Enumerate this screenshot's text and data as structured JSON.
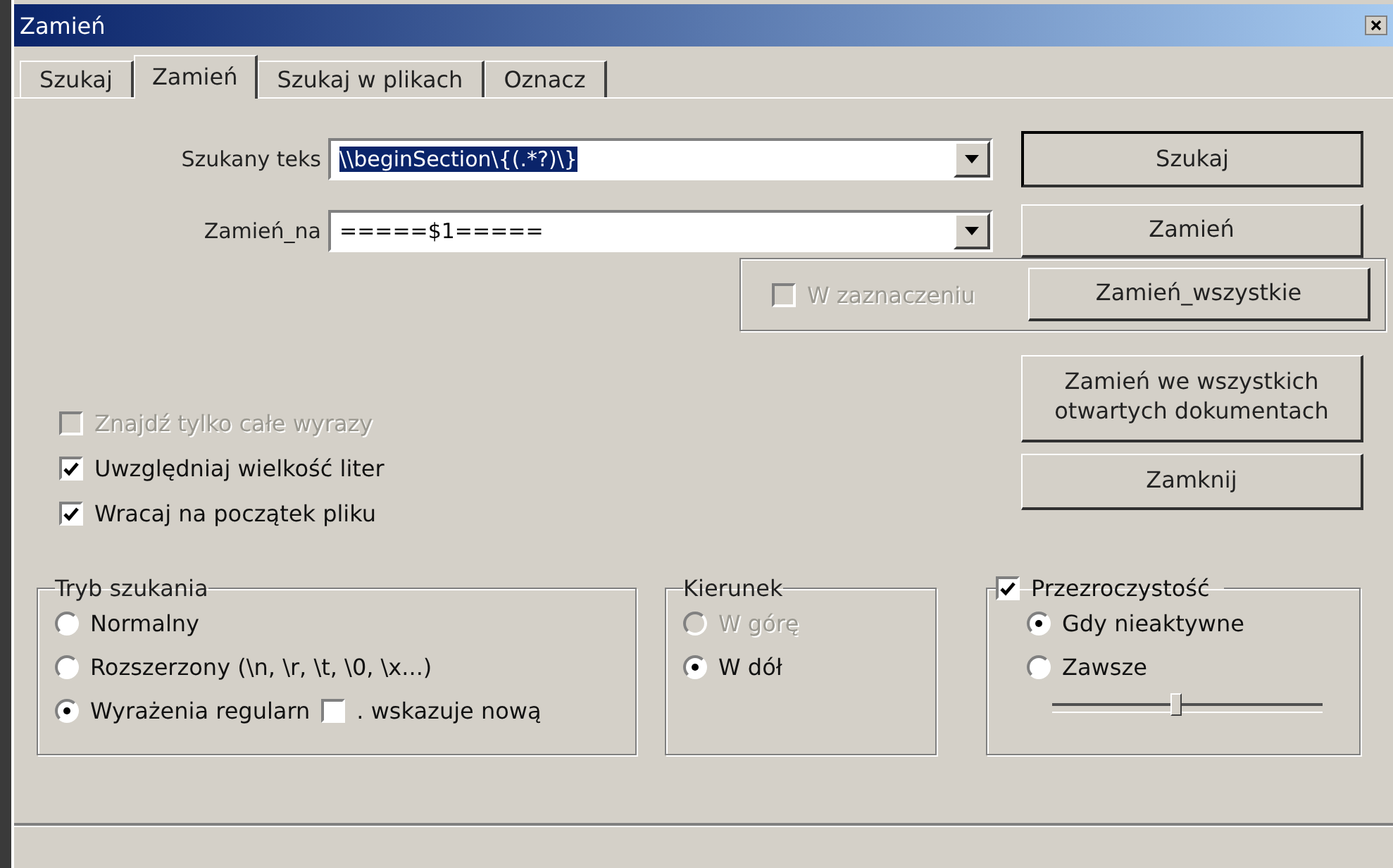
{
  "window": {
    "title": "Zamień"
  },
  "tabs": [
    {
      "label": "Szukaj",
      "selected": false
    },
    {
      "label": "Zamień",
      "selected": true
    },
    {
      "label": "Szukaj w plikach",
      "selected": false
    },
    {
      "label": "Oznacz",
      "selected": false
    }
  ],
  "fields": [
    {
      "label": "Szukany teks",
      "value": "\\\\beginSection\\{(.*?)\\}",
      "highlighted": true
    },
    {
      "label": "Zamień_na",
      "value": "=====$1=====",
      "highlighted": false
    }
  ],
  "buttons": [
    {
      "label": "Szukaj",
      "default": true
    },
    {
      "label": "Zamień",
      "default": false
    },
    {
      "label": "Zamień_wszystkie",
      "default": false
    },
    {
      "label": "Zamień we wszystkich otwartych dokumentach",
      "default": false
    },
    {
      "label": "Zamknij",
      "default": false
    }
  ],
  "in_selection": {
    "label": "W zaznaczeniu",
    "checked": false,
    "disabled": true
  },
  "options": [
    {
      "label": "Znajdź tylko całe wyrazy",
      "checked": false,
      "disabled": true
    },
    {
      "label": "Uwzględniaj wielkość liter",
      "checked": true,
      "disabled": false
    },
    {
      "label": "Wracaj na początek pliku",
      "checked": true,
      "disabled": false
    }
  ],
  "search_mode": {
    "title": "Tryb szukania",
    "options": [
      {
        "label": "Normalny",
        "selected": false
      },
      {
        "label": "Rozszerzony (\\n, \\r, \\t, \\0, \\x...)",
        "selected": false
      },
      {
        "label": "Wyrażenia regularn",
        "selected": true
      }
    ],
    "newline_option": {
      "label": ". wskazuje nową",
      "checked": false
    }
  },
  "direction": {
    "title": "Kierunek",
    "options": [
      {
        "label": "W górę",
        "selected": false,
        "disabled": true
      },
      {
        "label": "W dół",
        "selected": true,
        "disabled": false
      }
    ]
  },
  "transparency": {
    "label": "Przezroczystość",
    "checked": true,
    "options": [
      {
        "label": "Gdy nieaktywne",
        "selected": true
      },
      {
        "label": "Zawsze",
        "selected": false
      }
    ],
    "level": 0.46
  }
}
